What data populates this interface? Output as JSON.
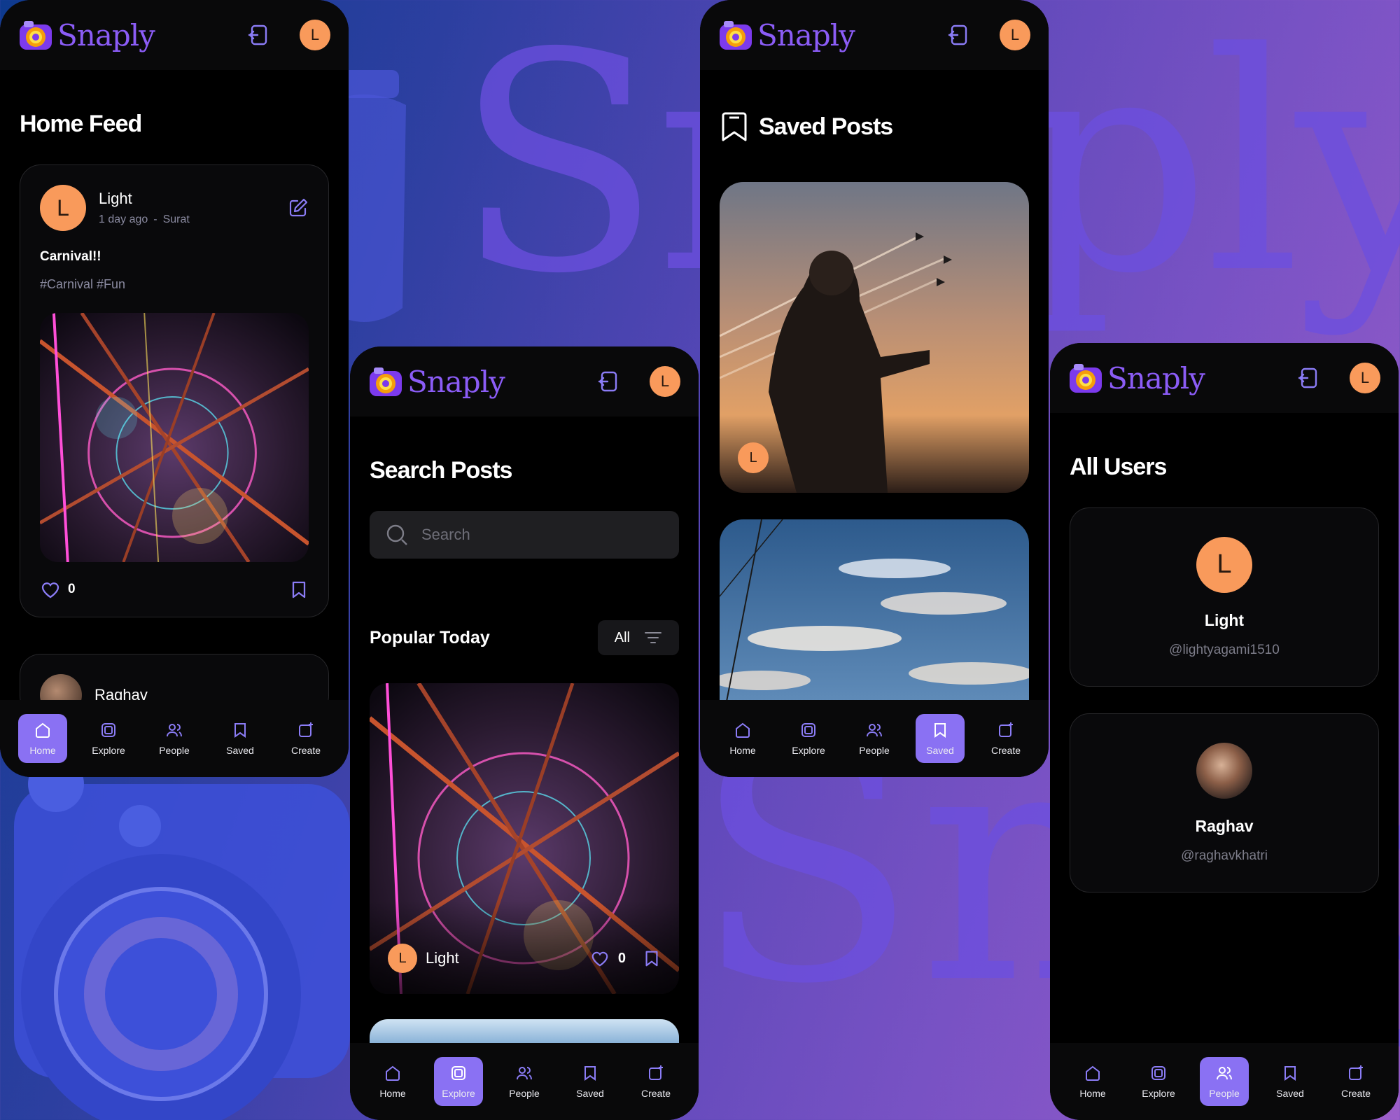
{
  "colors": {
    "accent": "#8b5cf6",
    "nav_active": "#8a71f3",
    "avatar": "#f99a5b",
    "surface": "#09090a"
  },
  "background": {
    "word_top": "Snaply",
    "word_bottom": "Snaply"
  },
  "app": {
    "name": "Snaply",
    "user_initial": "L"
  },
  "nav": {
    "home": "Home",
    "explore": "Explore",
    "people": "People",
    "saved": "Saved",
    "create": "Create"
  },
  "home": {
    "title": "Home Feed",
    "posts": [
      {
        "author": "Light",
        "initial": "L",
        "time": "1 day ago",
        "separator": "-",
        "location": "Surat",
        "caption": "Carnival!!",
        "tags": "#Carnival #Fun",
        "likes": "0",
        "image": "carnival-ferris-wheel"
      },
      {
        "author": "Raghav"
      }
    ]
  },
  "explore": {
    "title": "Search Posts",
    "search_placeholder": "Search",
    "section_title": "Popular Today",
    "filter_label": "All",
    "post": {
      "author": "Light",
      "initial": "L",
      "likes": "0",
      "image": "carnival-ferris-wheel"
    }
  },
  "saved": {
    "title": "Saved Posts",
    "items": [
      {
        "initial": "L",
        "image": "armored-soldier-sunset"
      },
      {
        "image": "blue-sky-clouds"
      }
    ]
  },
  "people": {
    "title": "All Users",
    "users": [
      {
        "name": "Light",
        "handle": "@lightyagami1510",
        "initial": "L"
      },
      {
        "name": "Raghav",
        "handle": "@raghavkhatri",
        "initial": ""
      }
    ]
  }
}
